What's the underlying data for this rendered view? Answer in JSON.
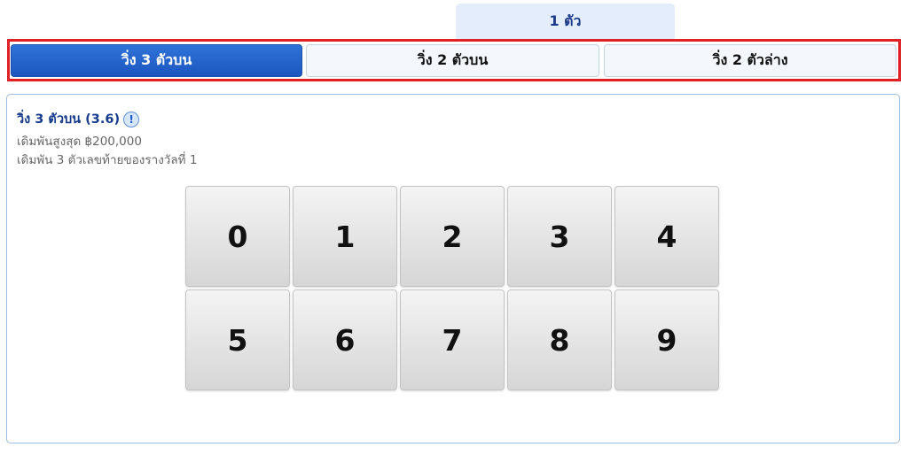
{
  "top_tab": {
    "label": "1 ตัว"
  },
  "bet_tabs": [
    {
      "label": "วิ่ง 3 ตัวบน",
      "active": true
    },
    {
      "label": "วิ่ง 2 ตัวบน",
      "active": false
    },
    {
      "label": "วิ่ง 2 ตัวล่าง",
      "active": false
    }
  ],
  "panel": {
    "title": "วิ่ง 3 ตัวบน (3.6)",
    "info_icon": "info-icon",
    "info_glyph": "!",
    "max_bet": "เดิมพันสูงสุด ฿200,000",
    "description": "เดิมพัน 3 ตัวเลขท้ายของรางวัลที่ 1"
  },
  "keypad": {
    "digits": [
      "0",
      "1",
      "2",
      "3",
      "4",
      "5",
      "6",
      "7",
      "8",
      "9"
    ]
  },
  "colors": {
    "active_tab": "#1c56c0",
    "highlight_frame": "#e02027",
    "title_text": "#173b8c"
  }
}
